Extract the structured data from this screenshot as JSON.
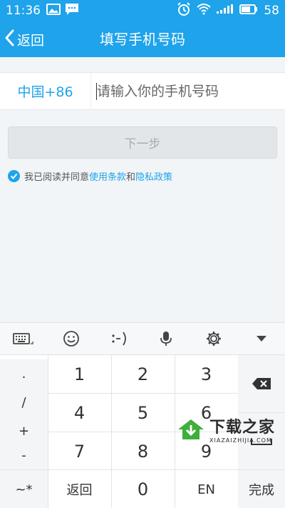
{
  "status_bar": {
    "time": "11:36",
    "battery": "58"
  },
  "header": {
    "back_label": "返回",
    "title": "填写手机号码"
  },
  "form": {
    "country_code": "中国+86",
    "phone_placeholder": "请输入你的手机号码",
    "next_label": "下一步",
    "agree_prefix": "我已阅读并同意",
    "terms_label": "使用条款",
    "and_label": "和",
    "privacy_label": "隐私政策"
  },
  "keyboard": {
    "symbols": [
      ".",
      "/",
      "+",
      "-"
    ],
    "digits": [
      "1",
      "2",
      "3",
      "4",
      "5",
      "6",
      "7",
      "8",
      "9"
    ],
    "bottom": {
      "special": "~*",
      "back": "返回",
      "zero": "0",
      "lang": "EN",
      "done": "完成"
    }
  },
  "watermark": {
    "main": "下载之家",
    "sub": "XIAZAIZHIJIA.COM"
  },
  "colors": {
    "accent": "#1fa3ea"
  }
}
